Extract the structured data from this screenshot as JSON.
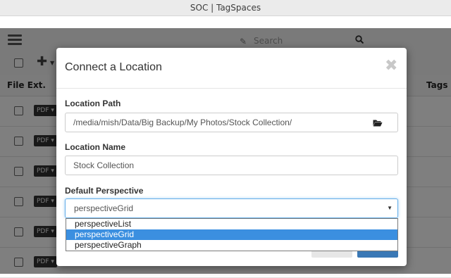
{
  "window": {
    "title": "SOC | TagSpaces"
  },
  "app": {
    "search_placeholder": "Search",
    "column_file_ext": "File Ext.",
    "column_tags": "Tags",
    "rows": [
      {
        "ext": "PDF ▾"
      },
      {
        "ext": "PDF ▾"
      },
      {
        "ext": "PDF ▾"
      },
      {
        "ext": "PDF ▾"
      },
      {
        "ext": "PDF ▾"
      },
      {
        "ext": "PDF ▾"
      }
    ]
  },
  "dialog": {
    "title": "Connect a Location",
    "close_glyph": "✖",
    "location_path_label": "Location Path",
    "location_path_value": "/media/mish/Data/Big Backup/My Photos/Stock Collection/",
    "location_name_label": "Location Name",
    "location_name_value": "Stock Collection",
    "perspective_label": "Default Perspective",
    "perspective_selected": "perspectiveGrid",
    "perspective_options": [
      "perspectiveList",
      "perspectiveGrid",
      "perspectiveGraph"
    ]
  },
  "colors": {
    "selection": "#3b8fe0",
    "focus_border": "#66afe9",
    "primary_button": "#3a78b5"
  }
}
